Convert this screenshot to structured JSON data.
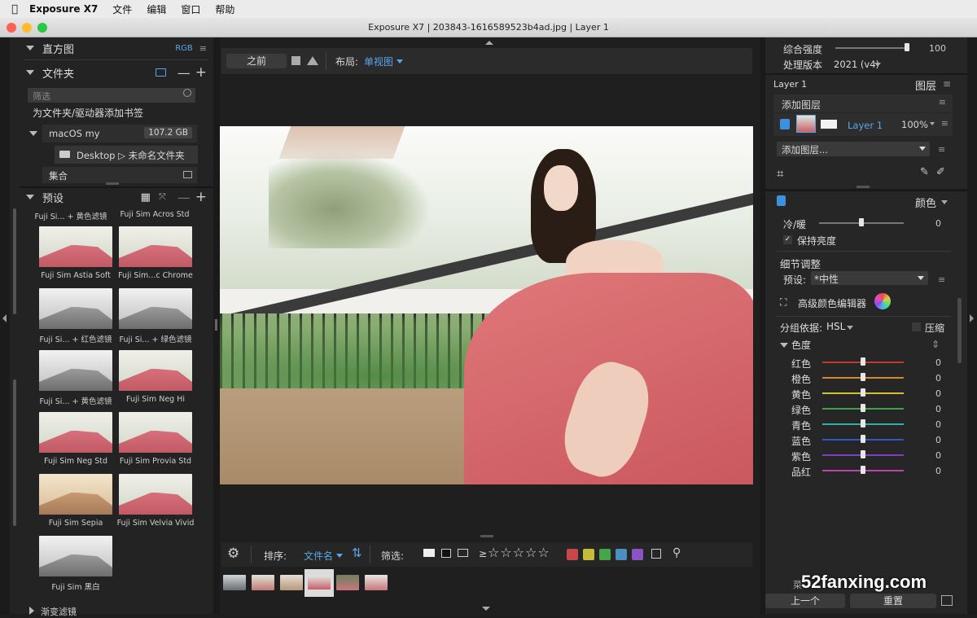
{
  "menubar": {
    "app": "Exposure X7",
    "items": [
      "文件",
      "编辑",
      "窗口",
      "帮助"
    ]
  },
  "window": {
    "title": "Exposure X7 | 203843-1616589523b4ad.jpg | Layer 1"
  },
  "left": {
    "histogram": {
      "title": "直方图",
      "mode": "RGB"
    },
    "folders": {
      "title": "文件夹",
      "filter_placeholder": "筛选",
      "bookmark_text": "为文件夹/驱动器添加书签",
      "drive": {
        "name": "macOS my",
        "size": "107.2 GB"
      },
      "path": "Desktop ▷ 未命名文件夹",
      "collections": "集合"
    },
    "presets": {
      "title": "预设",
      "top_labels": [
        "Fuji Si... + 黄色滤镜",
        "Fuji Sim Acros Std"
      ],
      "items": [
        {
          "label": "Fuji Sim Astia Soft",
          "tone": "color"
        },
        {
          "label": "Fuji Sim...c Chrome",
          "tone": "color"
        },
        {
          "label": "Fuji Si... + 红色滤镜",
          "tone": "bw"
        },
        {
          "label": "Fuji Si... + 绿色滤镜",
          "tone": "bw"
        },
        {
          "label": "Fuji Si... + 黄色滤镜",
          "tone": "bw"
        },
        {
          "label": "Fuji Sim Neg Hi",
          "tone": "color"
        },
        {
          "label": "Fuji Sim Neg Std",
          "tone": "color"
        },
        {
          "label": "Fuji Sim Provia Std",
          "tone": "color"
        },
        {
          "label": "Fuji Sim Sepia",
          "tone": "sepia"
        },
        {
          "label": "Fuji Sim Velvia Vivid",
          "tone": "color"
        },
        {
          "label": "Fuji Sim 黑白",
          "tone": "bw"
        }
      ],
      "next_group": "渐变滤镜"
    }
  },
  "center": {
    "toolbar": {
      "before": "之前",
      "layout_label": "布局:",
      "layout_value": "单视图"
    },
    "bottom": {
      "sort_label": "排序:",
      "sort_value": "文件名",
      "filter_label": "筛选:",
      "ge": "≥",
      "stars": "☆☆☆☆☆",
      "color_labels": [
        "#c8474a",
        "#c6bb3a",
        "#45a649",
        "#4c8fbf",
        "#8a55c2"
      ]
    }
  },
  "right": {
    "overall_strength": {
      "label": "综合强度",
      "value": "100",
      "fraction": 1.0
    },
    "process_version": {
      "label": "处理版本",
      "value": "2021 (v4)"
    },
    "layers": {
      "current": "Layer 1",
      "title": "图层",
      "add_layer": "添加图层",
      "layer_name": "Layer 1",
      "opacity": "100%",
      "add_layer_dropdown": "添加图层..."
    },
    "color": {
      "title": "颜色",
      "cool_warm": {
        "label": "冷/暖",
        "value": "0",
        "fraction": 0.5
      },
      "preserve_brightness": "保持亮度",
      "detail_title": "细节调整",
      "preset_label": "预设:",
      "preset_value": "*中性",
      "advanced_editor": "高级颜色编辑器",
      "group_label": "分组依据:",
      "group_value": "HSL",
      "compress": "压缩",
      "hue_title": "色度",
      "hues": [
        {
          "label": "红色",
          "value": "0",
          "fraction": 0.5,
          "color": "#c0392b"
        },
        {
          "label": "橙色",
          "value": "0",
          "fraction": 0.5,
          "color": "#d6862b"
        },
        {
          "label": "黄色",
          "value": "0",
          "fraction": 0.5,
          "color": "#cfc12f"
        },
        {
          "label": "绿色",
          "value": "0",
          "fraction": 0.5,
          "color": "#3fa447"
        },
        {
          "label": "青色",
          "value": "0",
          "fraction": 0.5,
          "color": "#2fb0a6"
        },
        {
          "label": "蓝色",
          "value": "0",
          "fraction": 0.5,
          "color": "#2f57c7"
        },
        {
          "label": "紫色",
          "value": "0",
          "fraction": 0.5,
          "color": "#7a3fc2"
        },
        {
          "label": "品红",
          "value": "0",
          "fraction": 0.5,
          "color": "#c23fb2"
        }
      ]
    },
    "footer": {
      "prev": "上一个",
      "reset": "重置"
    }
  },
  "watermark": "52fanxing.com"
}
